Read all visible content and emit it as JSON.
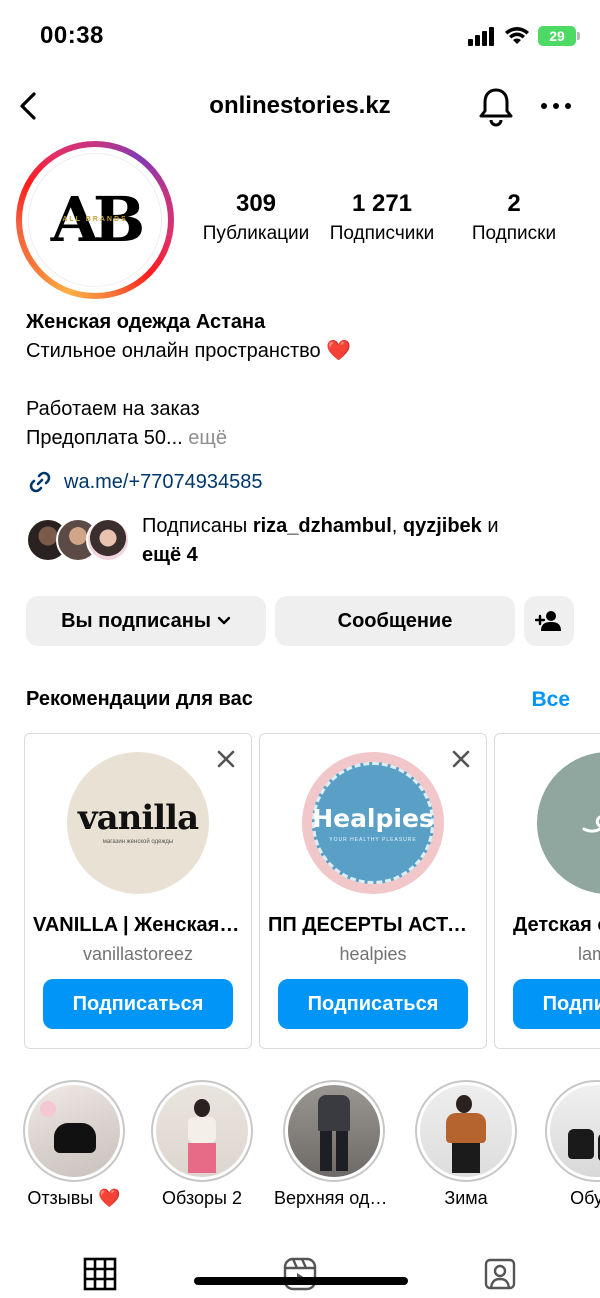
{
  "status_bar": {
    "time": "00:38",
    "battery": "29"
  },
  "nav": {
    "title": "onlinestories.kz"
  },
  "profile": {
    "avatar_logo": "AB",
    "avatar_logo_sub": "ALL BRANDS",
    "stats": [
      {
        "value": "309",
        "label": "Публикации"
      },
      {
        "value": "1 271",
        "label": "Подписчики"
      },
      {
        "value": "2",
        "label": "Подписки"
      }
    ],
    "name": "Женская одежда Астана",
    "bio_line1": "Стильное онлайн пространство ❤️",
    "bio_line2": "Работаем на заказ",
    "bio_line3": "Предоплата 50...",
    "more": "ещё",
    "link": "wa.me/+77074934585"
  },
  "followed_by": {
    "prefix": "Подписаны",
    "user1": "riza_dzhambul",
    "sep": ",",
    "user2": "qyzjibek",
    "and": "и",
    "rest": "ещё 4"
  },
  "buttons": {
    "following": "Вы подписаны",
    "message": "Сообщение"
  },
  "recommendations": {
    "title": "Рекомендации для вас",
    "see_all": "Все",
    "cards": [
      {
        "name": "VANILLA | Женская одежда",
        "username": "vanillastoreez",
        "follow": "Подписаться",
        "logo": "vanilla",
        "logo_sub": "магазин женской одежды"
      },
      {
        "name": "ПП ДЕСЕРТЫ АСТАНА",
        "username": "healpies",
        "follow": "Подписаться",
        "logo": "Healpies",
        "logo_sub": "YOUR HEALTHY PLEASURE"
      },
      {
        "name": "Детская одежда",
        "username": "lambkids",
        "follow": "Подписаться"
      }
    ]
  },
  "highlights": [
    {
      "label": "Отзывы ❤️"
    },
    {
      "label": "Обзоры 2"
    },
    {
      "label": "Верхняя одежда"
    },
    {
      "label": "Зима"
    },
    {
      "label": "Обувь"
    }
  ],
  "colors": {
    "accent": "#0095f6",
    "link": "#00376b",
    "muted": "#737373",
    "button_bg": "#efefef"
  }
}
